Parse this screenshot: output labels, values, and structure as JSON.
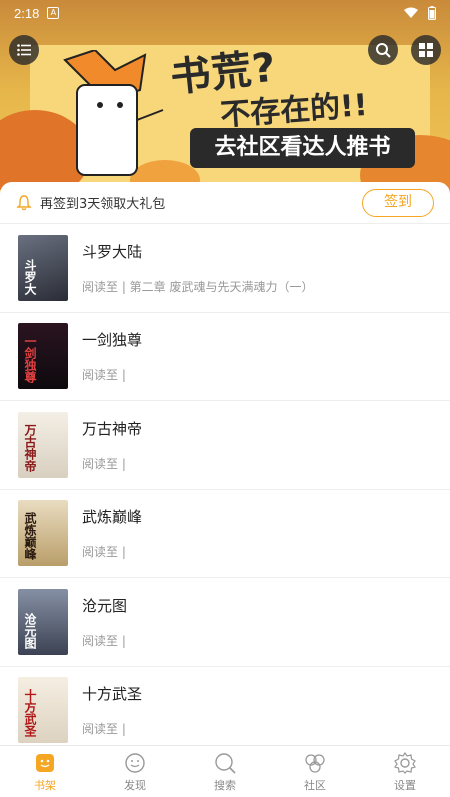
{
  "status_bar": {
    "time": "2:18",
    "badge": "A"
  },
  "banner": {
    "title": "书荒?",
    "subtitle": "不存在的!!",
    "cta": "去社区看达人推书"
  },
  "signin": {
    "text": "再签到3天领取大礼包",
    "button": "签到"
  },
  "books": [
    {
      "title": "斗罗大陆",
      "progress": "阅读至 | 第二章 废武魂与先天满魂力（一）",
      "cover_color": "#3c3f4a",
      "cover_text": "斗罗大"
    },
    {
      "title": "一剑独尊",
      "progress": "阅读至 |",
      "cover_color": "#171016",
      "cover_text": "一剑独尊"
    },
    {
      "title": "万古神帝",
      "progress": "阅读至 |",
      "cover_color": "#e8e2d6",
      "cover_text": "万古神帝"
    },
    {
      "title": "武炼巅峰",
      "progress": "阅读至 |",
      "cover_color": "#d9c9a4",
      "cover_text": "武炼巅峰"
    },
    {
      "title": "沧元图",
      "progress": "阅读至 |",
      "cover_color": "#5c6476",
      "cover_text": "沧元图"
    },
    {
      "title": "十方武圣",
      "progress": "阅读至 |",
      "cover_color": "#efe8dc",
      "cover_text": "十方武圣"
    }
  ],
  "tabs": [
    {
      "label": "书架",
      "icon": "bookshelf-icon",
      "active": true
    },
    {
      "label": "发现",
      "icon": "discover-icon",
      "active": false
    },
    {
      "label": "搜索",
      "icon": "search-icon",
      "active": false
    },
    {
      "label": "社区",
      "icon": "community-icon",
      "active": false
    },
    {
      "label": "设置",
      "icon": "settings-icon",
      "active": false
    }
  ],
  "colors": {
    "accent": "#f5a623",
    "text_muted": "#999999"
  }
}
